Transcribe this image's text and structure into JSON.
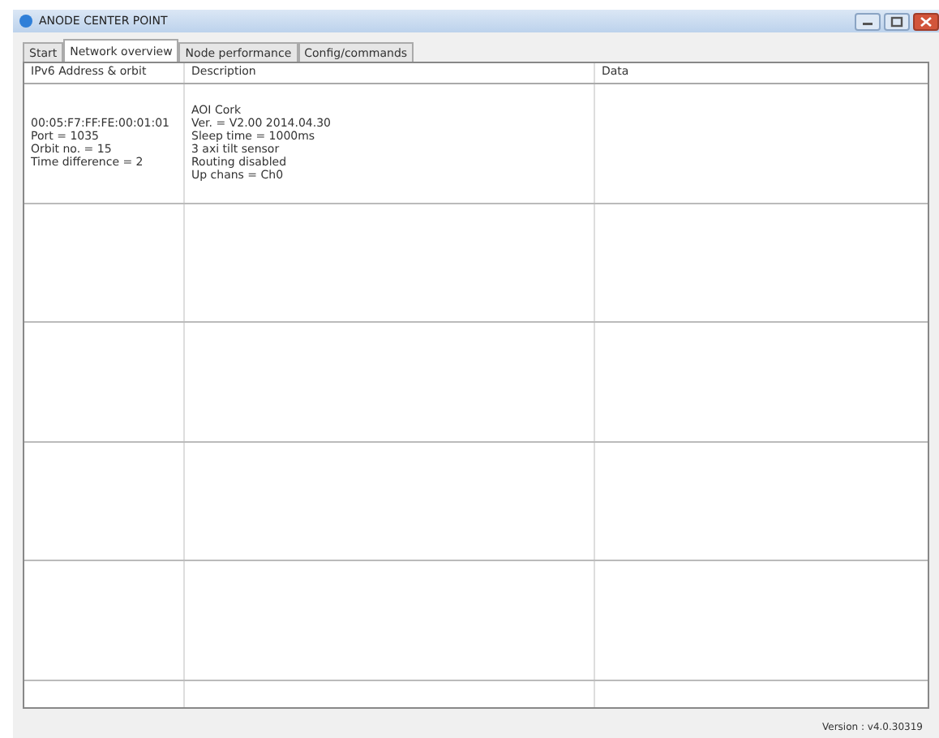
{
  "window": {
    "title": "ANODE CENTER POINT"
  },
  "tabs": [
    {
      "label": "Start",
      "selected": false
    },
    {
      "label": "Network overview",
      "selected": true
    },
    {
      "label": "Node performance",
      "selected": false
    },
    {
      "label": "Config/commands",
      "selected": false
    }
  ],
  "table": {
    "columns": [
      "IPv6 Address & orbit",
      "Description",
      "Data"
    ],
    "rows": [
      {
        "address": [
          "00:05:F7:FF:FE:00:01:01",
          "Port = 1035",
          "Orbit no. = 15",
          "Time difference = 2"
        ],
        "description": [
          "AOI Cork",
          "Ver. = V2.00 2014.04.30",
          "Sleep time = 1000ms",
          "3 axi tilt sensor",
          "Routing disabled",
          "Up chans = Ch0"
        ]
      }
    ]
  },
  "status_bar": {
    "version": "Version : v4.0.30319"
  }
}
